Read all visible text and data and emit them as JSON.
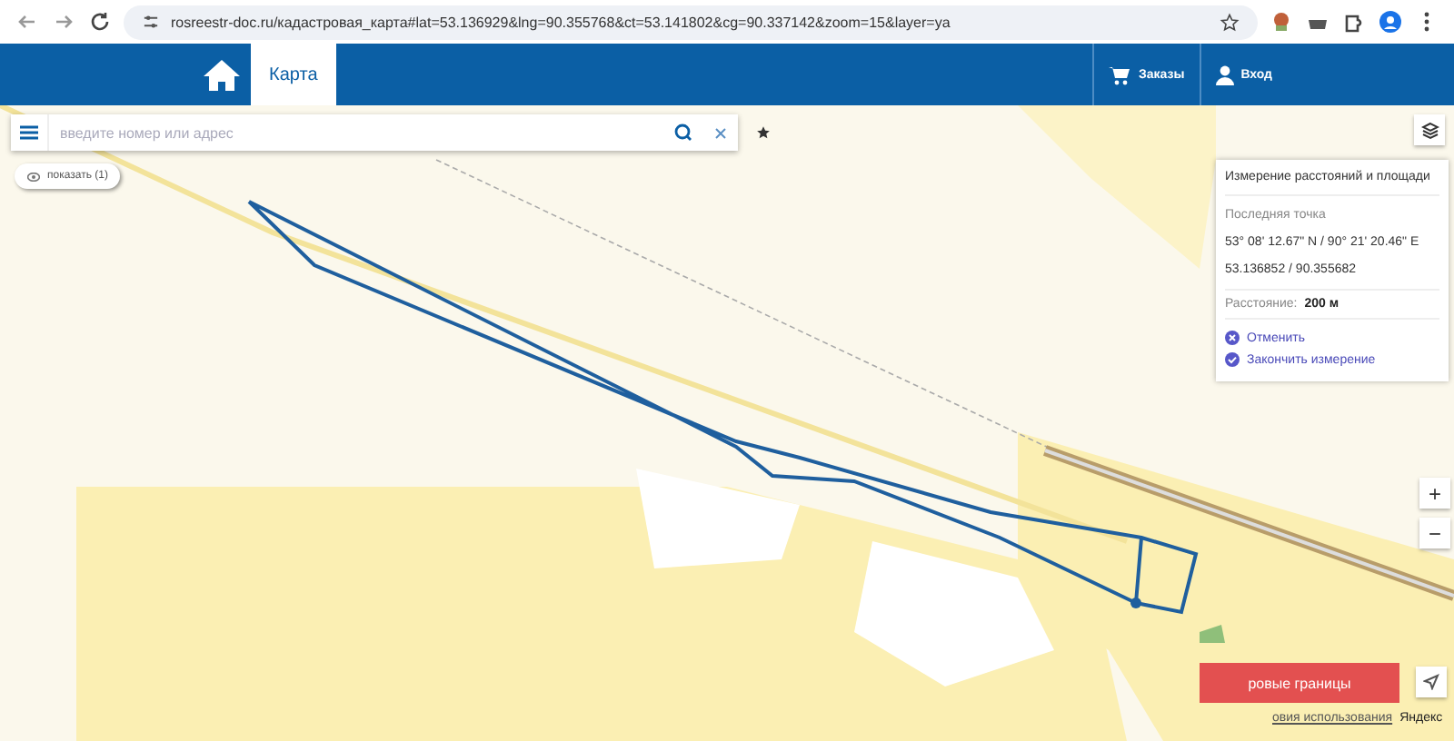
{
  "browser": {
    "url": "rosreestr-doc.ru/кадастровая_карта#lat=53.136929&lng=90.355768&ct=53.141802&cg=90.337142&zoom=15&layer=ya"
  },
  "header": {
    "nav": [
      {
        "label": "Карта",
        "selected": true
      }
    ],
    "actions": [
      {
        "label": "Заказы",
        "kind": "cart"
      },
      {
        "label": "Вход",
        "kind": "user"
      }
    ]
  },
  "search": {
    "placeholder": "введите номер или адрес"
  },
  "show_button": {
    "label": "показать (1)"
  },
  "measure_panel": {
    "title": "Измерение расстояний и площади",
    "last_point_label": "Последняя точка",
    "coordinates_dms": "53° 08' 12.67\" N / 90° 21' 20.46\" E",
    "coordinates_decimal": "53.136852 / 90.355682",
    "distance_label": "Расстояние:",
    "distance_value": "200 м",
    "actions": [
      {
        "label": "Отменить",
        "kind": "cancel"
      },
      {
        "label": "Закончить измерение",
        "kind": "finish"
      }
    ]
  },
  "zoom": {
    "in": "+",
    "out": "−"
  },
  "map": {
    "boundary_button": "ровые границы",
    "footer": [
      "овия использования",
      "Яндекс"
    ]
  }
}
